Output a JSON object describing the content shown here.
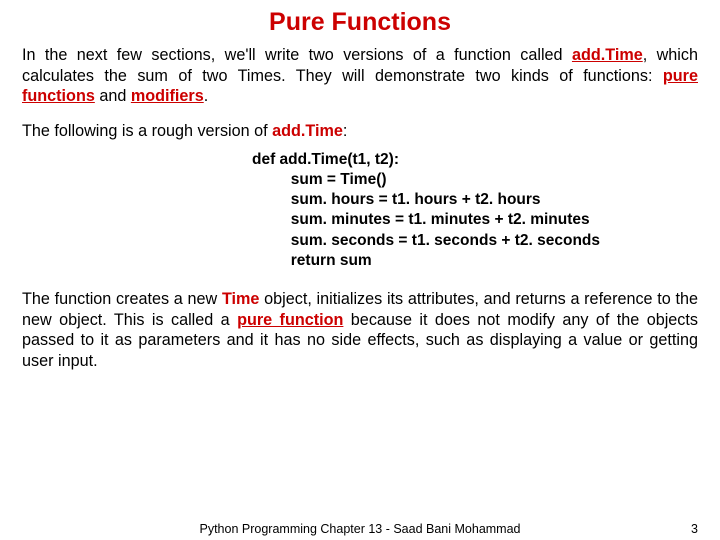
{
  "title": "Pure Functions",
  "para1": {
    "t1": "In the next few sections, we'll write two versions of a function called ",
    "addTime": "add.Time",
    "t2": ", which calculates the sum of two Times. They will demonstrate two kinds of functions: ",
    "pure": "pure functions",
    "t3": " and ",
    "mod": "modifiers",
    "t4": "."
  },
  "para2": {
    "t1": "The following is a rough version of ",
    "addTime": "add.Time",
    "t2": ":"
  },
  "code": {
    "l1": "def add.Time(t1, t2):",
    "l2": "         sum = Time()",
    "l3": "         sum. hours = t1. hours + t2. hours",
    "l4": "         sum. minutes = t1. minutes + t2. minutes",
    "l5": "         sum. seconds = t1. seconds + t2. seconds",
    "l6": "         return sum"
  },
  "para3": {
    "t1": "The function creates a new ",
    "time": "Time",
    "t2": " object, initializes its attributes, and returns a reference to the new object. This is called a ",
    "pure": "pure function",
    "t3": " because it does not modify any of the objects passed to it as parameters and it has no side effects, such as displaying a value or getting user input."
  },
  "footer": {
    "center": "Python Programming Chapter 13 - Saad Bani Mohammad",
    "page": "3"
  }
}
